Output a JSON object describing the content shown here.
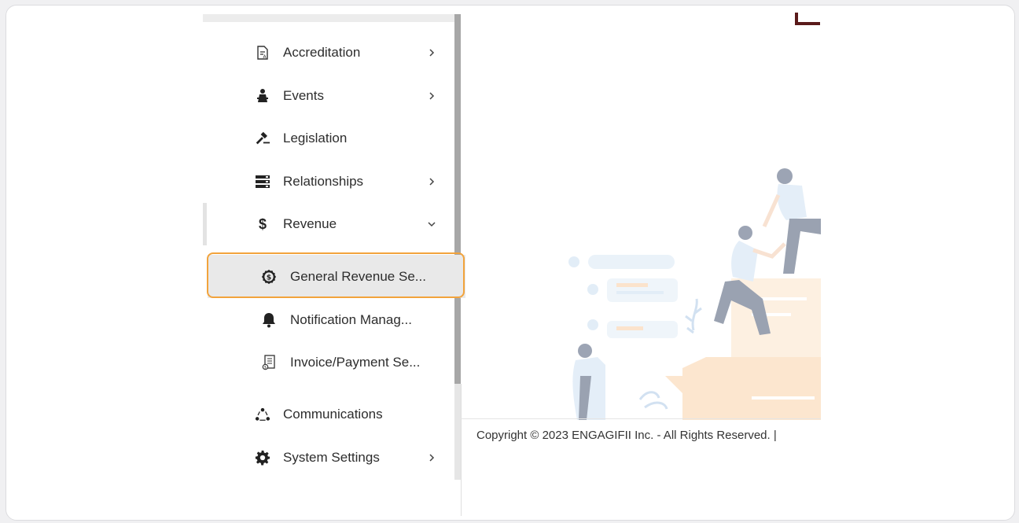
{
  "sidebar": {
    "items": [
      {
        "label": "Accreditation",
        "icon": "accreditation-icon",
        "chevron": "right"
      },
      {
        "label": "Events",
        "icon": "events-icon",
        "chevron": "right"
      },
      {
        "label": "Legislation",
        "icon": "gavel-icon",
        "chevron": ""
      },
      {
        "label": "Relationships",
        "icon": "relationships-icon",
        "chevron": "right"
      },
      {
        "label": "Revenue",
        "icon": "dollar-icon",
        "chevron": "down"
      }
    ],
    "revenue_sub_items": [
      {
        "label": "General Revenue Se...",
        "icon": "dollar-circle-icon"
      },
      {
        "label": "Notification Manag...",
        "icon": "bell-icon"
      },
      {
        "label": "Invoice/Payment Se...",
        "icon": "invoice-icon"
      }
    ],
    "more_items": [
      {
        "label": "Communications",
        "icon": "communications-icon",
        "chevron": ""
      },
      {
        "label": "System Settings",
        "icon": "gear-icon",
        "chevron": "right"
      }
    ]
  },
  "revenue_symbol": "$",
  "footer": {
    "copyright": "Copyright © 2023 ENGAGIFII Inc. - All Rights Reserved. |"
  },
  "colors": {
    "highlight": "#f2a33c",
    "accent_dark": "#5a1a1a"
  }
}
